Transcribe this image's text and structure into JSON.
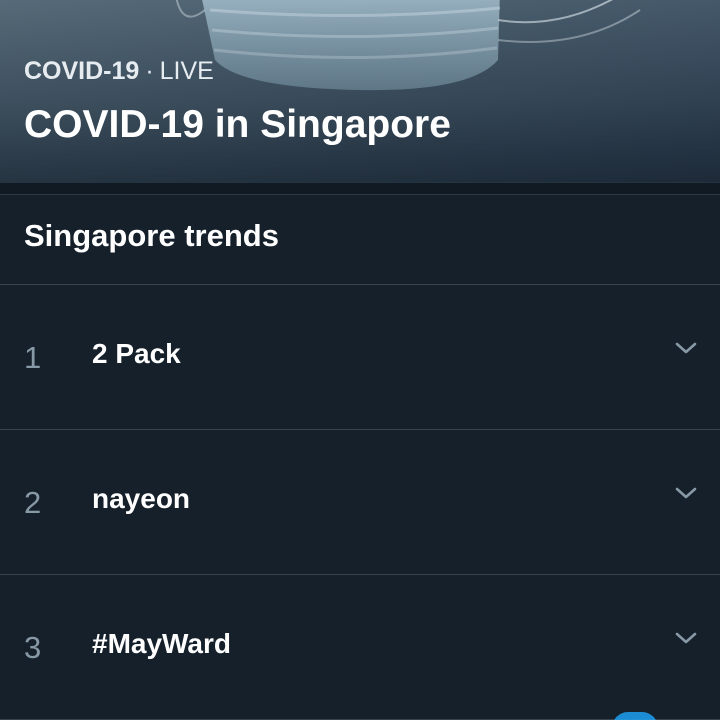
{
  "hero": {
    "topic": "COVID-19",
    "separator": "·",
    "status": "LIVE",
    "title": "COVID-19 in Singapore"
  },
  "section": {
    "title": "Singapore trends"
  },
  "trends": [
    {
      "rank": "1",
      "name": "2 Pack",
      "icon": "chevron-down-icon"
    },
    {
      "rank": "2",
      "name": "nayeon",
      "icon": "chevron-down-icon"
    },
    {
      "rank": "3",
      "name": "#MayWard",
      "icon": "chevron-down-icon"
    }
  ],
  "colors": {
    "background": "#15202b",
    "divider": "#38444d",
    "secondary_text": "#8899a6",
    "primary_text": "#ffffff",
    "accent": "#1da1f2"
  }
}
